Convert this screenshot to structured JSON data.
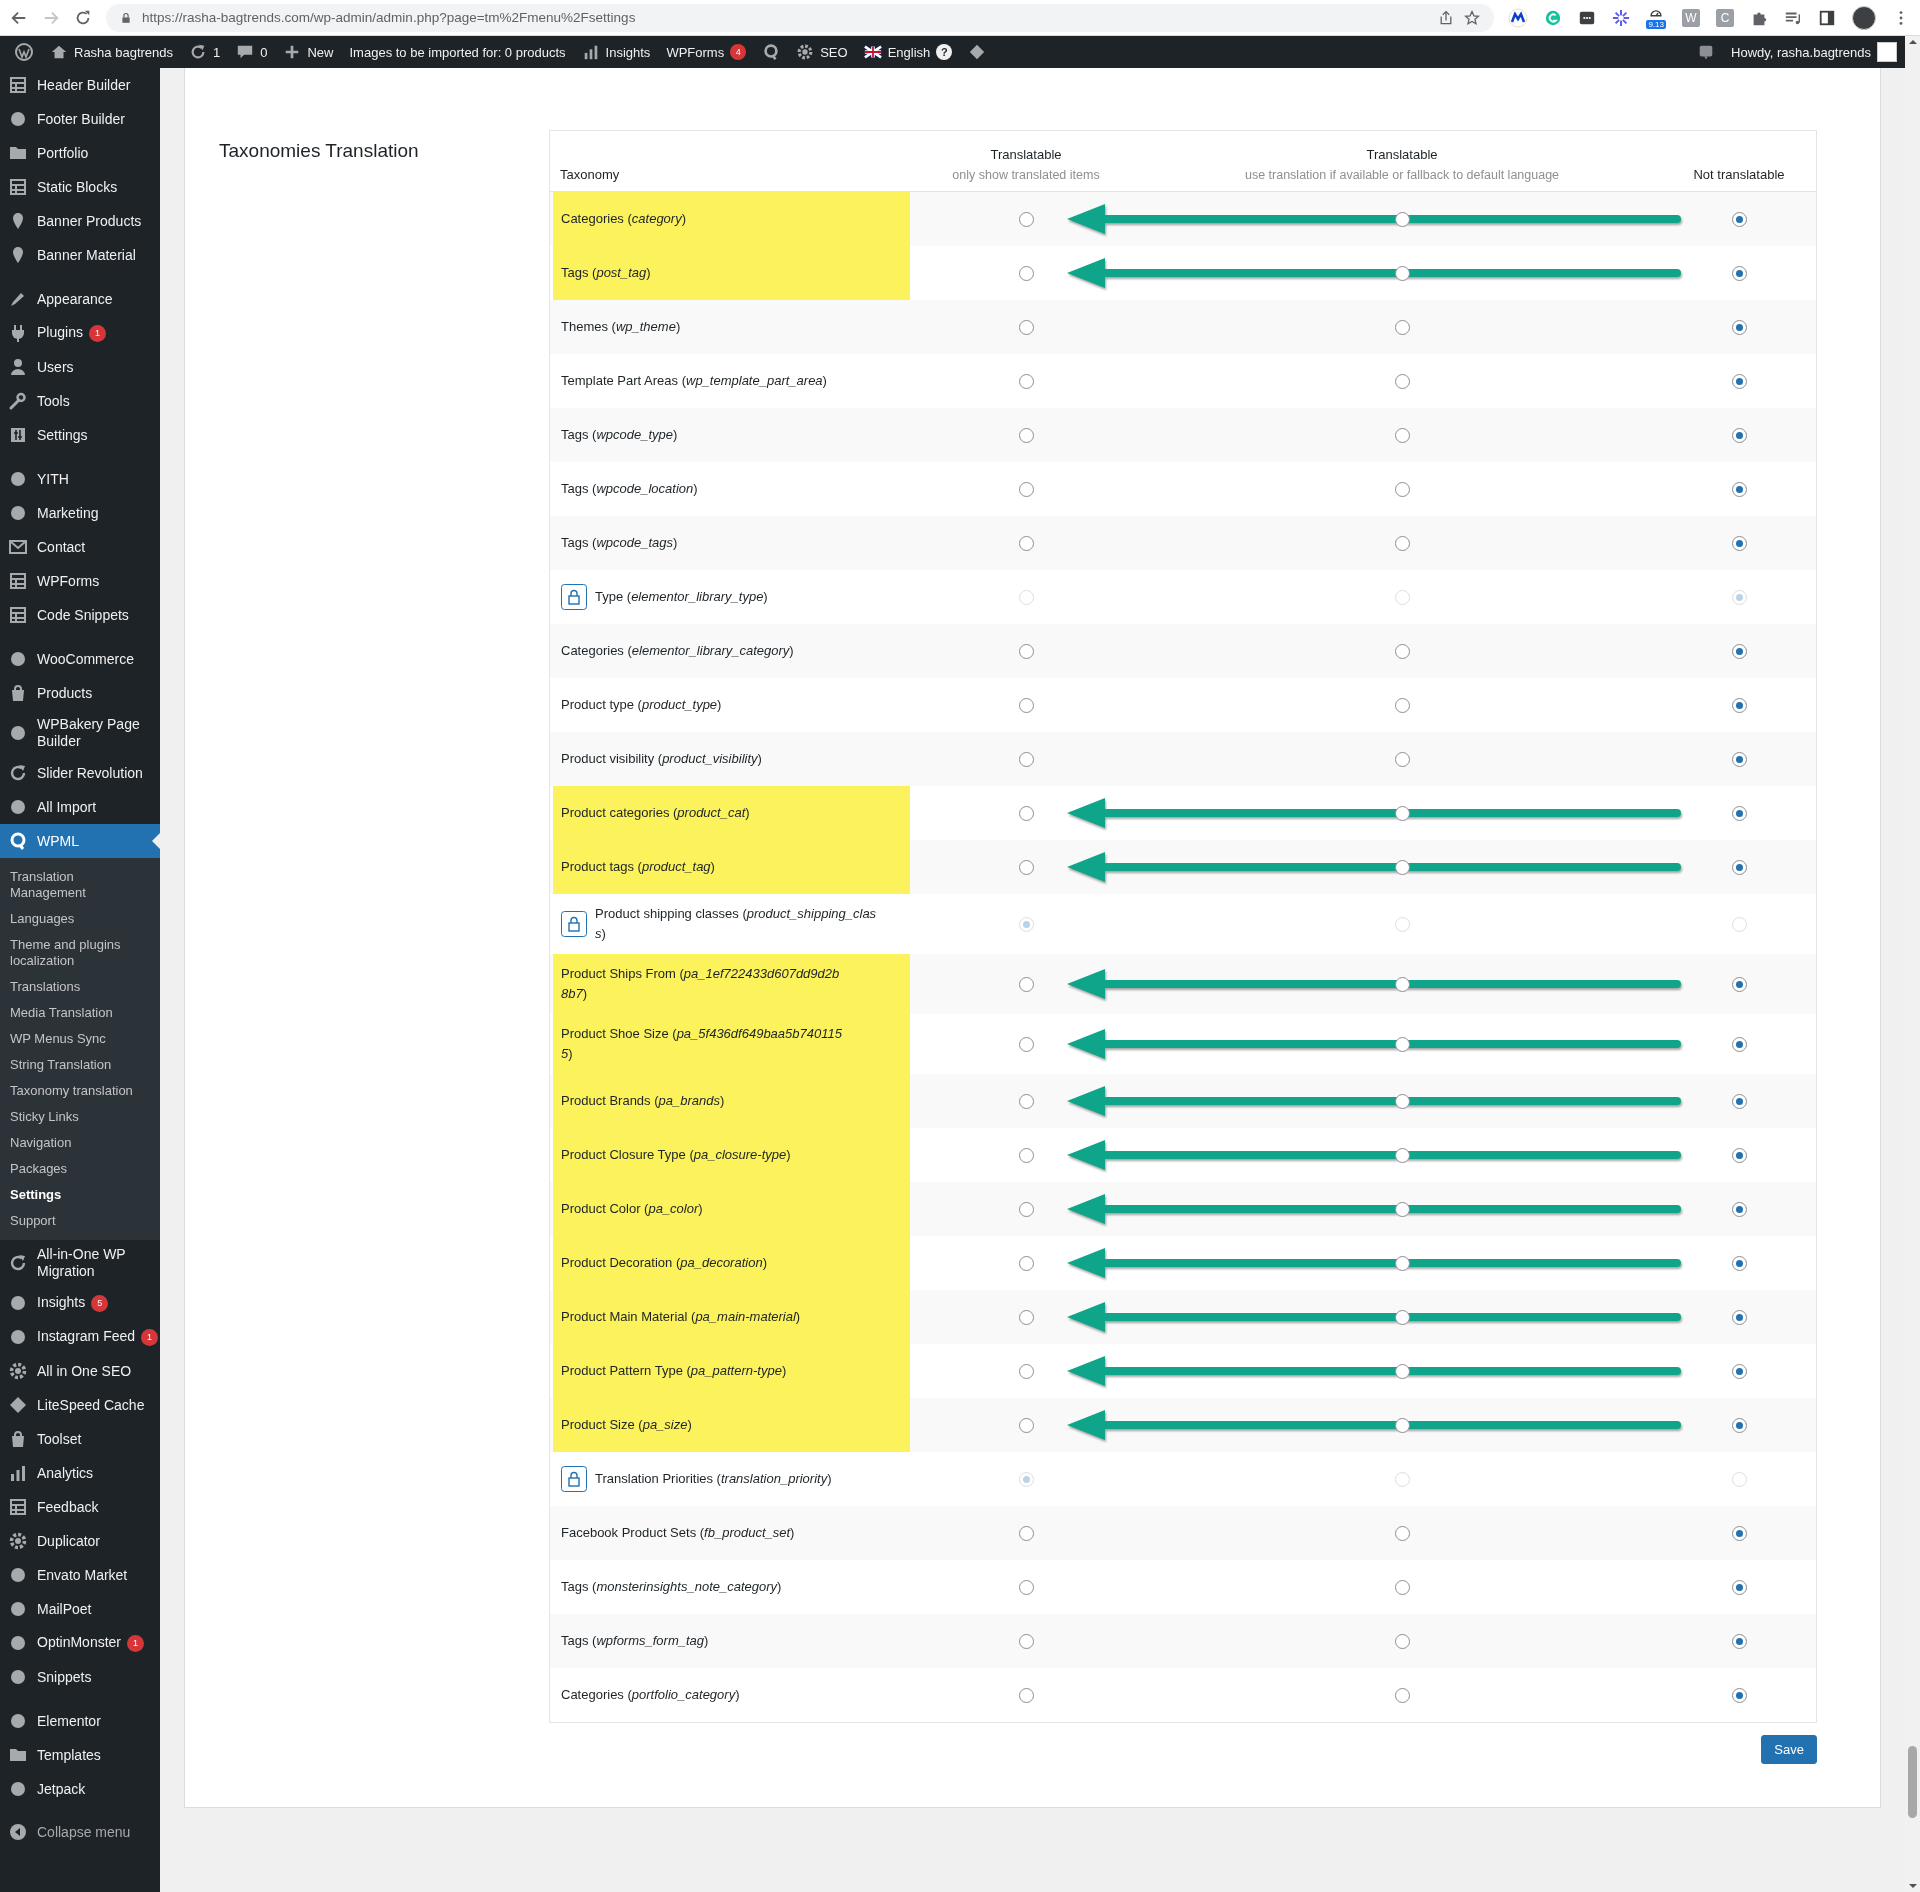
{
  "browser": {
    "url": "https://rasha-bagtrends.com/wp-admin/admin.php?page=tm%2Fmenu%2Fsettings",
    "extension_badge": "9.13",
    "extension_letters": [
      "W",
      "C"
    ]
  },
  "admin_bar": {
    "items": [
      {
        "kind": "wp"
      },
      {
        "kind": "site",
        "label": "Rasha bagtrends"
      },
      {
        "kind": "updates",
        "label": "1"
      },
      {
        "kind": "comments",
        "label": "0"
      },
      {
        "kind": "new",
        "label": "New"
      },
      {
        "kind": "text",
        "label": "Images to be imported for: 0 products"
      },
      {
        "kind": "insights",
        "label": "Insights"
      },
      {
        "kind": "wpforms",
        "label": "WPForms",
        "badge": "4"
      },
      {
        "kind": "wpml"
      },
      {
        "kind": "seo",
        "label": "SEO"
      },
      {
        "kind": "language",
        "label": "English",
        "help": "?"
      },
      {
        "kind": "diamond"
      }
    ],
    "greeting": "Howdy, rasha.bagtrends"
  },
  "admin_menu": {
    "groups": [
      {
        "items": [
          {
            "label": "Header Builder",
            "selected": false
          },
          {
            "label": "Footer Builder",
            "selected": false
          },
          {
            "label": "Portfolio",
            "selected": false
          },
          {
            "label": "Static Blocks",
            "selected": false
          },
          {
            "label": "Banner Products",
            "selected": false
          },
          {
            "label": "Banner Material",
            "selected": false
          }
        ]
      },
      {
        "items": [
          {
            "label": "Appearance",
            "selected": false
          },
          {
            "label": "Plugins",
            "selected": false,
            "badge": "1"
          },
          {
            "label": "Users",
            "selected": false
          },
          {
            "label": "Tools",
            "selected": false
          },
          {
            "label": "Settings",
            "selected": false
          }
        ]
      },
      {
        "items": [
          {
            "label": "YITH",
            "selected": false
          },
          {
            "label": "Marketing",
            "selected": false
          },
          {
            "label": "Contact",
            "selected": false
          },
          {
            "label": "WPForms",
            "selected": false
          },
          {
            "label": "Code Snippets",
            "selected": false
          }
        ]
      },
      {
        "items": [
          {
            "label": "WooCommerce",
            "selected": false
          },
          {
            "label": "Products",
            "selected": false
          },
          {
            "label": "WPBakery Page Builder",
            "selected": false
          },
          {
            "label": "Slider Revolution",
            "selected": false
          },
          {
            "label": "All Import",
            "selected": false
          },
          {
            "label": "WPML",
            "selected": true,
            "submenu": [
              {
                "label": "Translation Management",
                "selected": false
              },
              {
                "label": "Languages",
                "selected": false
              },
              {
                "label": "Theme and plugins localization",
                "selected": false
              },
              {
                "label": "Translations",
                "selected": false
              },
              {
                "label": "Media Translation",
                "selected": false
              },
              {
                "label": "WP Menus Sync",
                "selected": false
              },
              {
                "label": "String Translation",
                "selected": false
              },
              {
                "label": "Taxonomy translation",
                "selected": false
              },
              {
                "label": "Sticky Links",
                "selected": false
              },
              {
                "label": "Navigation",
                "selected": false
              },
              {
                "label": "Packages",
                "selected": false
              },
              {
                "label": "Settings",
                "selected": true
              },
              {
                "label": "Support",
                "selected": false
              }
            ]
          },
          {
            "label": "All-in-One WP Migration",
            "selected": false
          },
          {
            "label": "Insights",
            "selected": false,
            "badge": "5"
          },
          {
            "label": "Instagram Feed",
            "selected": false,
            "badge": "1"
          },
          {
            "label": "All in One SEO",
            "selected": false
          },
          {
            "label": "LiteSpeed Cache",
            "selected": false
          },
          {
            "label": "Toolset",
            "selected": false
          },
          {
            "label": "Analytics",
            "selected": false
          },
          {
            "label": "Feedback",
            "selected": false
          },
          {
            "label": "Duplicator",
            "selected": false
          },
          {
            "label": "Envato Market",
            "selected": false
          },
          {
            "label": "MailPoet",
            "selected": false
          },
          {
            "label": "OptinMonster",
            "selected": false,
            "badge": "1"
          },
          {
            "label": "Snippets",
            "selected": false
          }
        ]
      },
      {
        "items": [
          {
            "label": "Elementor",
            "selected": false
          },
          {
            "label": "Templates",
            "selected": false
          },
          {
            "label": "Jetpack",
            "selected": false
          }
        ]
      }
    ],
    "collapse": "Collapse menu"
  },
  "page": {
    "section_title": "Taxonomies Translation",
    "table": {
      "columns": [
        {
          "title": "Taxonomy"
        },
        {
          "title": "Translatable",
          "subtitle": "only show translated items"
        },
        {
          "title": "Translatable",
          "subtitle": "use translation if available or fallback to default language"
        },
        {
          "title": "Not translatable"
        }
      ],
      "rows": [
        {
          "label": "Categories (*category*)",
          "locked": false,
          "highlighted": true,
          "radios": [
            {
              "selected": false
            },
            {
              "selected": false
            },
            {
              "selected": true
            }
          ]
        },
        {
          "label": "Tags (*post_tag*)",
          "locked": false,
          "highlighted": true,
          "radios": [
            {
              "selected": false
            },
            {
              "selected": false
            },
            {
              "selected": true
            }
          ]
        },
        {
          "label": "Themes (*wp_theme*)",
          "locked": false,
          "highlighted": false,
          "radios": [
            {
              "selected": false
            },
            {
              "selected": false
            },
            {
              "selected": true
            }
          ]
        },
        {
          "label": "Template Part Areas (*wp_template_part_area*)",
          "locked": false,
          "highlighted": false,
          "radios": [
            {
              "selected": false
            },
            {
              "selected": false
            },
            {
              "selected": true
            }
          ]
        },
        {
          "label": "Tags (*wpcode_type*)",
          "locked": false,
          "highlighted": false,
          "radios": [
            {
              "selected": false
            },
            {
              "selected": false
            },
            {
              "selected": true
            }
          ]
        },
        {
          "label": "Tags (*wpcode_location*)",
          "locked": false,
          "highlighted": false,
          "radios": [
            {
              "selected": false
            },
            {
              "selected": false
            },
            {
              "selected": true
            }
          ]
        },
        {
          "label": "Tags (*wpcode_tags*)",
          "locked": false,
          "highlighted": false,
          "radios": [
            {
              "selected": false
            },
            {
              "selected": false
            },
            {
              "selected": true
            }
          ]
        },
        {
          "label": "Type (*elementor_library_type*)",
          "locked": true,
          "highlighted": false,
          "radios": [
            {
              "selected": false
            },
            {
              "selected": false
            },
            {
              "selected": true
            }
          ]
        },
        {
          "label": "Categories (*elementor_library_category*)",
          "locked": false,
          "highlighted": false,
          "radios": [
            {
              "selected": false
            },
            {
              "selected": false
            },
            {
              "selected": true
            }
          ]
        },
        {
          "label": "Product type (*product_type*)",
          "locked": false,
          "highlighted": false,
          "radios": [
            {
              "selected": false
            },
            {
              "selected": false
            },
            {
              "selected": true
            }
          ]
        },
        {
          "label": "Product visibility (*product_visibility*)",
          "locked": false,
          "highlighted": false,
          "radios": [
            {
              "selected": false
            },
            {
              "selected": false
            },
            {
              "selected": true
            }
          ]
        },
        {
          "label": "Product categories (*product_cat*)",
          "locked": false,
          "highlighted": true,
          "radios": [
            {
              "selected": false
            },
            {
              "selected": false
            },
            {
              "selected": true
            }
          ]
        },
        {
          "label": "Product tags (*product_tag*)",
          "locked": false,
          "highlighted": true,
          "radios": [
            {
              "selected": false
            },
            {
              "selected": false
            },
            {
              "selected": true
            }
          ]
        },
        {
          "label": "Product shipping classes (*product_shipping_class*)",
          "locked": true,
          "highlighted": false,
          "radios": [
            {
              "selected": true
            },
            {
              "selected": false
            },
            {
              "selected": false
            }
          ]
        },
        {
          "label": "Product Ships From (*pa_1ef722433d607dd9d2b8b7*)",
          "locked": false,
          "highlighted": true,
          "radios": [
            {
              "selected": false
            },
            {
              "selected": false
            },
            {
              "selected": true
            }
          ]
        },
        {
          "label": "Product Shoe Size (*pa_5f436df649baa5b7401155*)",
          "locked": false,
          "highlighted": true,
          "radios": [
            {
              "selected": false
            },
            {
              "selected": false
            },
            {
              "selected": true
            }
          ]
        },
        {
          "label": "Product Brands (*pa_brands*)",
          "locked": false,
          "highlighted": true,
          "radios": [
            {
              "selected": false
            },
            {
              "selected": false
            },
            {
              "selected": true
            }
          ]
        },
        {
          "label": "Product Closure Type (*pa_closure-type*)",
          "locked": false,
          "highlighted": true,
          "radios": [
            {
              "selected": false
            },
            {
              "selected": false
            },
            {
              "selected": true
            }
          ]
        },
        {
          "label": "Product Color (*pa_color*)",
          "locked": false,
          "highlighted": true,
          "radios": [
            {
              "selected": false
            },
            {
              "selected": false
            },
            {
              "selected": true
            }
          ]
        },
        {
          "label": "Product Decoration (*pa_decoration*)",
          "locked": false,
          "highlighted": true,
          "radios": [
            {
              "selected": false
            },
            {
              "selected": false
            },
            {
              "selected": true
            }
          ]
        },
        {
          "label": "Product Main Material (*pa_main-material*)",
          "locked": false,
          "highlighted": true,
          "radios": [
            {
              "selected": false
            },
            {
              "selected": false
            },
            {
              "selected": true
            }
          ]
        },
        {
          "label": "Product Pattern Type (*pa_pattern-type*)",
          "locked": false,
          "highlighted": true,
          "radios": [
            {
              "selected": false
            },
            {
              "selected": false
            },
            {
              "selected": true
            }
          ]
        },
        {
          "label": "Product Size (*pa_size*)",
          "locked": false,
          "highlighted": true,
          "radios": [
            {
              "selected": false
            },
            {
              "selected": false
            },
            {
              "selected": true
            }
          ]
        },
        {
          "label": "Translation Priorities (*translation_priority*)",
          "locked": true,
          "highlighted": false,
          "radios": [
            {
              "selected": true
            },
            {
              "selected": false
            },
            {
              "selected": false
            }
          ]
        },
        {
          "label": "Facebook Product Sets (*fb_product_set*)",
          "locked": false,
          "highlighted": false,
          "radios": [
            {
              "selected": false
            },
            {
              "selected": false
            },
            {
              "selected": true
            }
          ]
        },
        {
          "label": "Tags (*monsterinsights_note_category*)",
          "locked": false,
          "highlighted": false,
          "radios": [
            {
              "selected": false
            },
            {
              "selected": false
            },
            {
              "selected": true
            }
          ]
        },
        {
          "label": "Tags (*wpforms_form_tag*)",
          "locked": false,
          "highlighted": false,
          "radios": [
            {
              "selected": false
            },
            {
              "selected": false
            },
            {
              "selected": true
            }
          ]
        },
        {
          "label": "Categories (*portfolio_category*)",
          "locked": false,
          "highlighted": false,
          "radios": [
            {
              "selected": false
            },
            {
              "selected": false
            },
            {
              "selected": true
            }
          ]
        }
      ]
    },
    "save_button": "Save"
  }
}
